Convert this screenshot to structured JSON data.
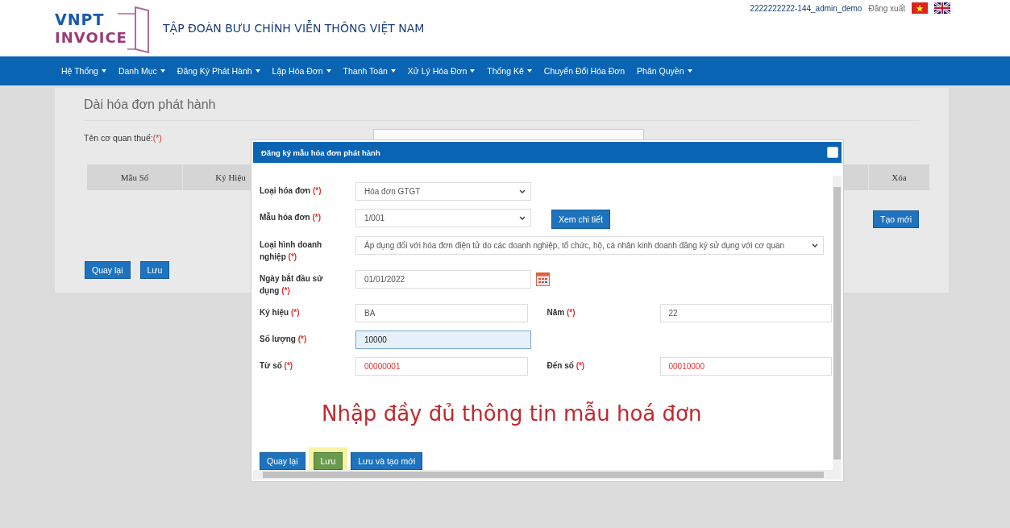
{
  "header": {
    "logo_top": "VNPT",
    "logo_bottom": "INVOICE",
    "org_name": "TẬP  ĐOÀN BƯU CHÍNH VIỄN THÔNG VIỆT NAM",
    "user": "2222222222-144_admin_demo",
    "logout": "Đăng xuất"
  },
  "nav": [
    {
      "label": "Hệ Thống",
      "has_menu": true
    },
    {
      "label": "Danh Mục",
      "has_menu": true
    },
    {
      "label": "Đăng Ký Phát Hành",
      "has_menu": true
    },
    {
      "label": "Lập Hóa Đơn",
      "has_menu": true
    },
    {
      "label": "Thanh Toán",
      "has_menu": true
    },
    {
      "label": "Xử Lý Hóa Đơn",
      "has_menu": true
    },
    {
      "label": "Thống Kê",
      "has_menu": true
    },
    {
      "label": "Chuyển Đổi Hóa Đơn",
      "has_menu": false
    },
    {
      "label": "Phân Quyền",
      "has_menu": true
    }
  ],
  "page": {
    "title": "Dài hóa đơn phát hành",
    "tax_office_label": "Tên cơ quan thuế:",
    "tax_office_mark": "(*)",
    "columns": [
      "Mẫu Số",
      "Ký Hiệu",
      "Xóa"
    ],
    "create_button": "Tạo mới",
    "buttons": [
      "Quay lại",
      "Lưu"
    ]
  },
  "modal": {
    "title": "Đăng ký mẫu hóa đơn phát hành",
    "rows": [
      {
        "fields": [
          {
            "label": "Loại hóa đơn",
            "mark": "(*)",
            "kind": "select",
            "value": "Hóa đơn GTGT",
            "focused": false,
            "emphasized": false
          }
        ]
      },
      {
        "fields": [
          {
            "label": "Mẫu hóa đơn",
            "mark": "(*)",
            "kind": "select",
            "value": "1/001",
            "focused": false,
            "emphasized": false
          }
        ],
        "button": "Xem chi tiết"
      },
      {
        "fields": [
          {
            "label": "Loại hình doanh nghiệp",
            "mark": "(*)",
            "kind": "select-wide",
            "value": "Áp dụng đối với hóa đơn điện tử do các doanh nghiệp, tổ chức, hộ, cá nhân kinh doanh đăng ký sử dụng với cơ quan",
            "focused": false,
            "emphasized": false
          }
        ]
      },
      {
        "fields": [
          {
            "label": "Ngày bắt đầu sử dụng",
            "mark": "(*)",
            "kind": "date",
            "value": "01/01/2022",
            "focused": false,
            "emphasized": false
          }
        ]
      },
      {
        "fields": [
          {
            "label": "Ký hiệu",
            "mark": "(*)",
            "kind": "text",
            "value": "BA",
            "focused": false,
            "emphasized": false
          },
          {
            "label": "Năm",
            "mark": "(*)",
            "kind": "text",
            "value": "22",
            "focused": false,
            "emphasized": false
          }
        ]
      },
      {
        "fields": [
          {
            "label": "Số lượng",
            "mark": "(*)",
            "kind": "text",
            "value": "10000",
            "focused": true,
            "emphasized": false
          }
        ]
      },
      {
        "fields": [
          {
            "label": "Từ số",
            "mark": "(*)",
            "kind": "text",
            "value": "00000001",
            "focused": false,
            "emphasized": true
          },
          {
            "label": "Đến số",
            "mark": "(*)",
            "kind": "text",
            "value": "00010000",
            "focused": false,
            "emphasized": true
          }
        ]
      }
    ],
    "caption": "Nhập đầy đủ thông tin mẫu hoá đơn",
    "buttons": [
      {
        "label": "Quay lại",
        "hovered": false
      },
      {
        "label": "Lưu",
        "hovered": true
      },
      {
        "label": "Lưu và tạo mới",
        "hovered": false
      }
    ]
  }
}
